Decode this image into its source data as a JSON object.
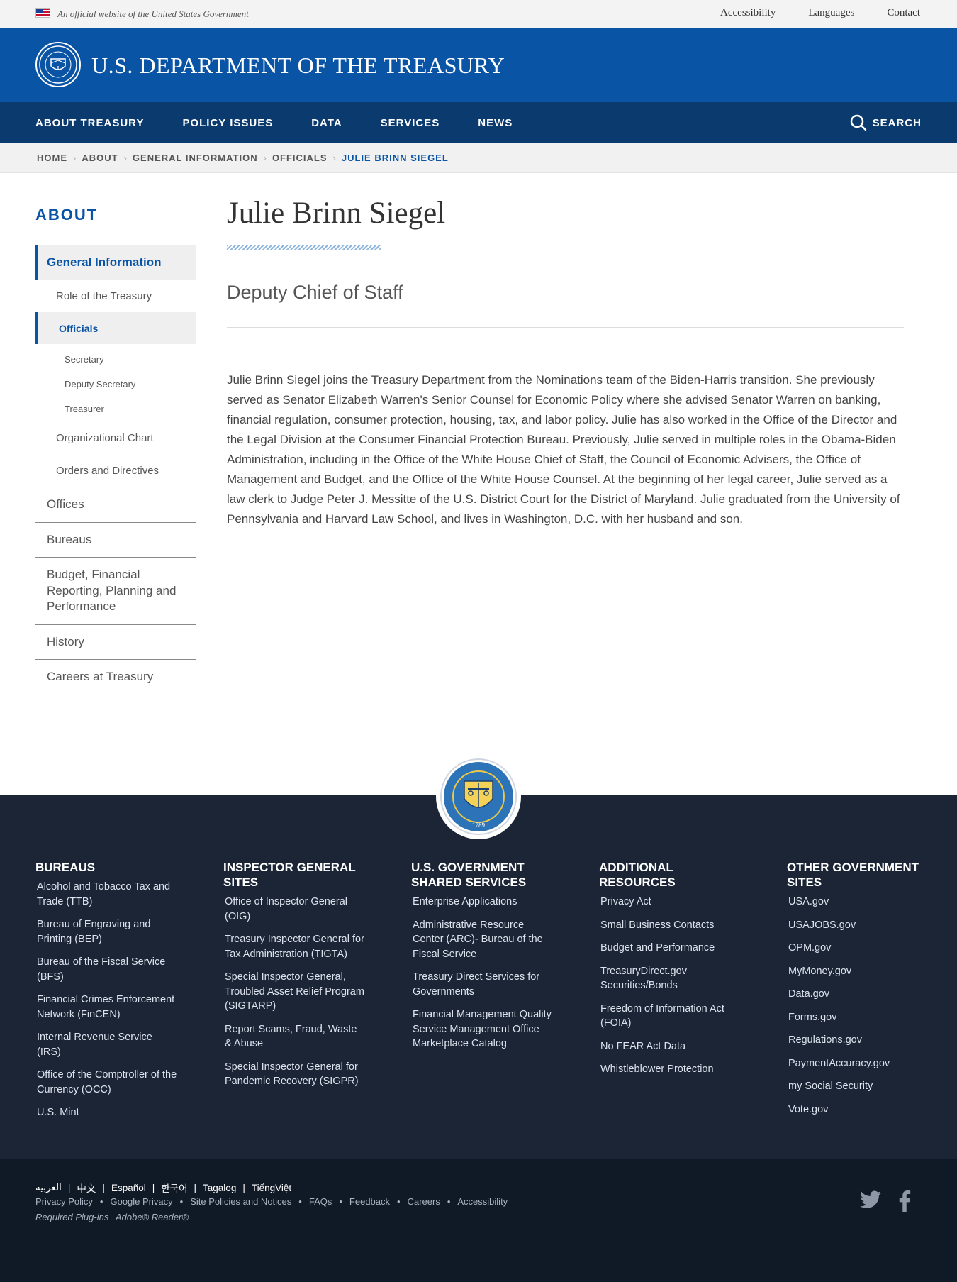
{
  "gov_bar": {
    "official_text": "An official website of the United States Government",
    "links": [
      "Accessibility",
      "Languages",
      "Contact"
    ]
  },
  "header": {
    "title": "U.S. DEPARTMENT OF THE TREASURY"
  },
  "nav": {
    "items": [
      "ABOUT TREASURY",
      "POLICY ISSUES",
      "DATA",
      "SERVICES",
      "NEWS"
    ],
    "search_label": "SEARCH"
  },
  "breadcrumb": [
    "HOME",
    "ABOUT",
    "GENERAL INFORMATION",
    "OFFICIALS",
    "JULIE BRINN SIEGEL"
  ],
  "sidebar": {
    "title": "ABOUT",
    "active_section": "General Information",
    "sub_items": {
      "role": "Role of the Treasury",
      "officials": "Officials",
      "officials_children": [
        "Secretary",
        "Deputy Secretary",
        "Treasurer"
      ],
      "org_chart": "Organizational Chart",
      "orders": "Orders and Directives"
    },
    "top_items": [
      "Offices",
      "Bureaus",
      "Budget, Financial Reporting, Planning and Performance",
      "History",
      "Careers at Treasury"
    ]
  },
  "main": {
    "title": "Julie Brinn Siegel",
    "subtitle": "Deputy Chief of Staff",
    "bio": "Julie Brinn Siegel joins the Treasury Department from the Nominations team of the Biden-Harris transition. She previously served as Senator Elizabeth Warren's Senior Counsel for Economic Policy where she advised Senator Warren on banking, financial regulation, consumer protection, housing, tax, and labor policy. Julie has also worked in the Office of the Director and the Legal Division at the Consumer Financial Protection Bureau. Previously, Julie served in multiple roles in the Obama-Biden Administration, including in the Office of the White House Chief of Staff, the Council of Economic Advisers, the Office of Management and Budget, and the Office of the White House Counsel. At the beginning of her legal career, Julie served as a law clerk to Judge Peter J. Messitte of the U.S. District Court for the District of Maryland. Julie graduated from the University of Pennsylvania and Harvard Law School, and lives in Washington, D.C. with her husband and son."
  },
  "footer": {
    "seal_year": "1789",
    "columns": [
      {
        "heading": "BUREAUS",
        "links": [
          "Alcohol and Tobacco Tax and Trade (TTB)",
          "Bureau of Engraving and Printing (BEP)",
          "Bureau of the Fiscal Service (BFS)",
          "Financial Crimes Enforcement Network (FinCEN)",
          "Internal Revenue Service (IRS)",
          "Office of the Comptroller of the Currency (OCC)",
          "U.S. Mint"
        ]
      },
      {
        "heading": "INSPECTOR GENERAL SITES",
        "links": [
          "Office of Inspector General (OIG)",
          "Treasury Inspector General for Tax Administration (TIGTA)",
          "Special Inspector General, Troubled Asset Relief Program (SIGTARP)",
          "Report Scams, Fraud, Waste & Abuse",
          "Special Inspector General for Pandemic Recovery (SIGPR)"
        ]
      },
      {
        "heading": "U.S. GOVERNMENT SHARED SERVICES",
        "links": [
          "Enterprise Applications",
          "Administrative Resource Center (ARC)- Bureau of the Fiscal Service",
          "Treasury Direct Services for Governments",
          "Financial Management Quality Service Management Office Marketplace Catalog"
        ]
      },
      {
        "heading": "ADDITIONAL RESOURCES",
        "links": [
          "Privacy Act",
          "Small Business Contacts",
          "Budget and Performance",
          "TreasuryDirect.gov Securities/Bonds",
          "Freedom of Information Act (FOIA)",
          "No FEAR Act Data",
          "Whistleblower Protection"
        ]
      },
      {
        "heading": "OTHER GOVERNMENT SITES",
        "links": [
          "USA.gov",
          "USAJOBS.gov",
          "OPM.gov",
          "MyMoney.gov",
          "Data.gov",
          "Forms.gov",
          "Regulations.gov",
          "PaymentAccuracy.gov",
          "my Social Security",
          "Vote.gov"
        ]
      }
    ]
  },
  "subfooter": {
    "languages": [
      "العربية",
      "中文",
      "Español",
      "한국어",
      "Tagalog",
      "TiếngViệt"
    ],
    "legal": [
      "Privacy Policy",
      "Google Privacy",
      "Site Policies and Notices",
      "FAQs",
      "Feedback",
      "Careers",
      "Accessibility"
    ],
    "plugins_label": "Required Plug-ins",
    "plugins_item": "Adobe® Reader®"
  },
  "colors": {
    "brand_blue": "#0a54a6",
    "nav_navy": "#0b3a6e",
    "footer_bg": "#1b2535",
    "subfooter_bg": "#101a26"
  },
  "icons": [
    "us-flag-icon",
    "treasury-seal-icon",
    "search-icon",
    "chevron-right-icon",
    "twitter-icon",
    "facebook-icon"
  ]
}
